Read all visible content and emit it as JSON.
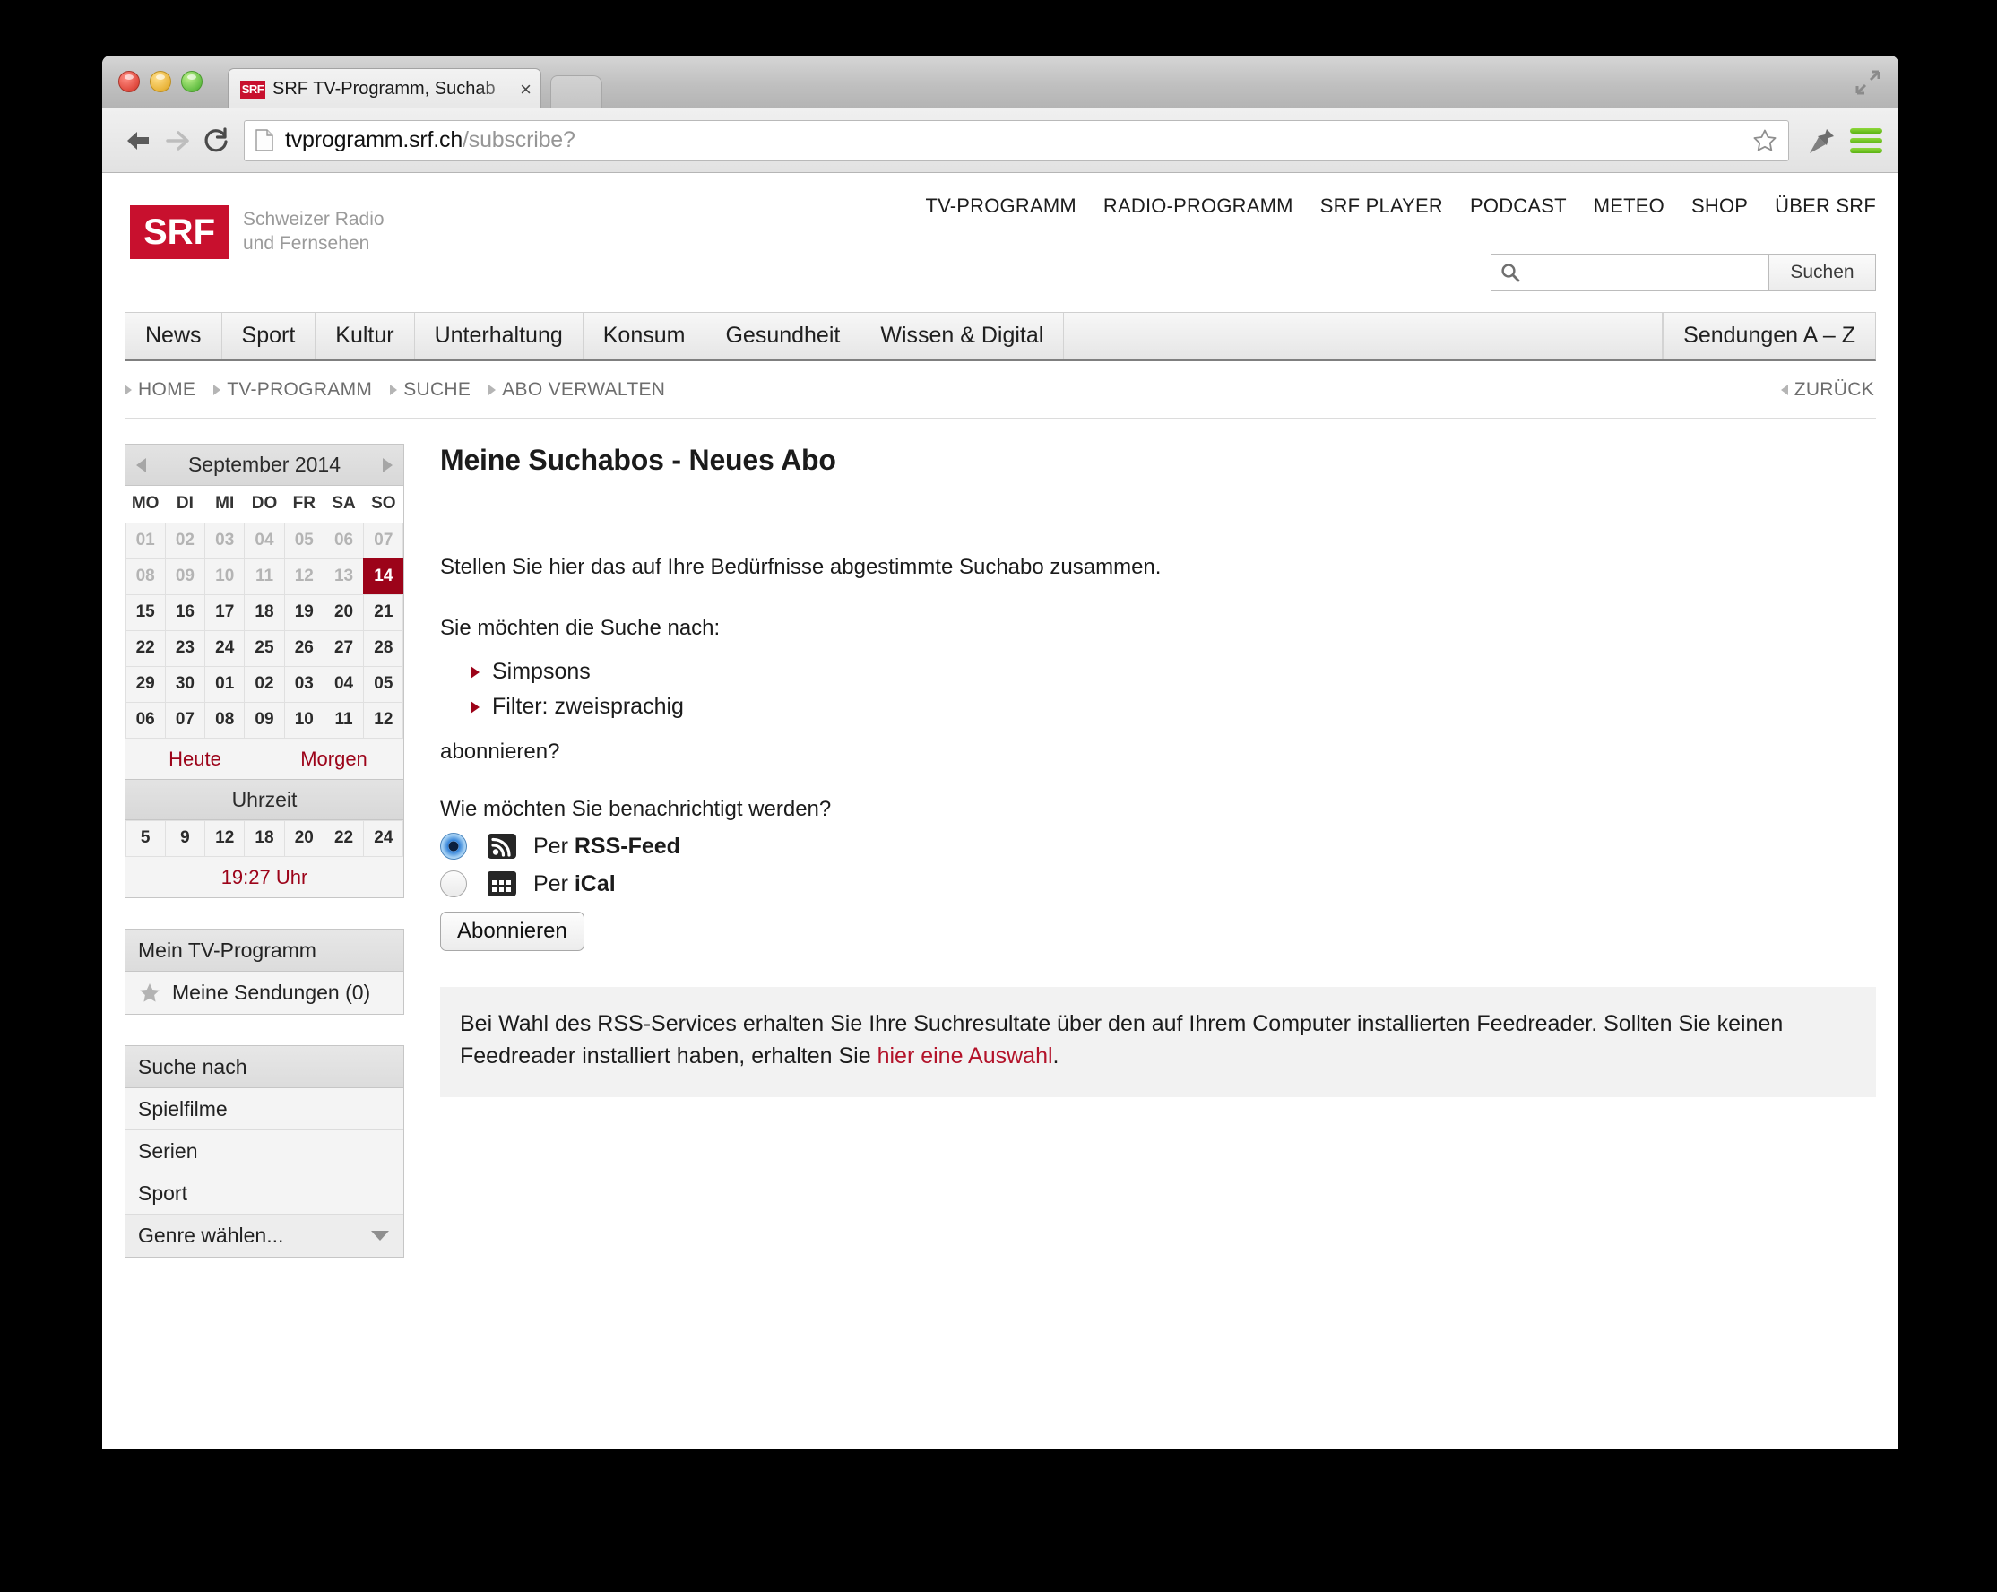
{
  "browser": {
    "tab": {
      "favicon_label": "SRF",
      "title": "SRF TV-Programm, Suchab",
      "close_label": "×"
    },
    "url": {
      "domain": "tvprogramm.srf.ch",
      "path": "/subscribe?"
    }
  },
  "site": {
    "logo": {
      "mark": "SRF",
      "line1": "Schweizer Radio",
      "line2": "und Fernsehen"
    },
    "top_nav": [
      "TV-PROGRAMM",
      "RADIO-PROGRAMM",
      "SRF PLAYER",
      "PODCAST",
      "METEO",
      "SHOP",
      "ÜBER SRF"
    ],
    "search": {
      "placeholder": "",
      "value": "",
      "submit_label": "Suchen"
    },
    "main_nav": [
      "News",
      "Sport",
      "Kultur",
      "Unterhaltung",
      "Konsum",
      "Gesundheit",
      "Wissen & Digital"
    ],
    "main_nav_right": "Sendungen A – Z",
    "breadcrumb": [
      "HOME",
      "TV-PROGRAMM",
      "SUCHE",
      "ABO VERWALTEN"
    ],
    "back_label": "ZURÜCK"
  },
  "sidebar": {
    "calendar": {
      "title": "September 2014",
      "dow": [
        "MO",
        "DI",
        "MI",
        "DO",
        "FR",
        "SA",
        "SO"
      ],
      "weeks": [
        [
          {
            "d": "01",
            "s": "muted"
          },
          {
            "d": "02",
            "s": "muted"
          },
          {
            "d": "03",
            "s": "muted"
          },
          {
            "d": "04",
            "s": "muted"
          },
          {
            "d": "05",
            "s": "muted"
          },
          {
            "d": "06",
            "s": "muted"
          },
          {
            "d": "07",
            "s": "muted"
          }
        ],
        [
          {
            "d": "08",
            "s": "muted"
          },
          {
            "d": "09",
            "s": "muted"
          },
          {
            "d": "10",
            "s": "muted"
          },
          {
            "d": "11",
            "s": "muted"
          },
          {
            "d": "12",
            "s": "muted"
          },
          {
            "d": "13",
            "s": "muted"
          },
          {
            "d": "14",
            "s": "today"
          }
        ],
        [
          {
            "d": "15",
            "s": ""
          },
          {
            "d": "16",
            "s": ""
          },
          {
            "d": "17",
            "s": ""
          },
          {
            "d": "18",
            "s": ""
          },
          {
            "d": "19",
            "s": ""
          },
          {
            "d": "20",
            "s": ""
          },
          {
            "d": "21",
            "s": ""
          }
        ],
        [
          {
            "d": "22",
            "s": ""
          },
          {
            "d": "23",
            "s": ""
          },
          {
            "d": "24",
            "s": ""
          },
          {
            "d": "25",
            "s": ""
          },
          {
            "d": "26",
            "s": ""
          },
          {
            "d": "27",
            "s": ""
          },
          {
            "d": "28",
            "s": ""
          }
        ],
        [
          {
            "d": "29",
            "s": ""
          },
          {
            "d": "30",
            "s": ""
          },
          {
            "d": "01",
            "s": ""
          },
          {
            "d": "02",
            "s": ""
          },
          {
            "d": "03",
            "s": ""
          },
          {
            "d": "04",
            "s": ""
          },
          {
            "d": "05",
            "s": ""
          }
        ],
        [
          {
            "d": "06",
            "s": ""
          },
          {
            "d": "07",
            "s": ""
          },
          {
            "d": "08",
            "s": ""
          },
          {
            "d": "09",
            "s": ""
          },
          {
            "d": "10",
            "s": ""
          },
          {
            "d": "11",
            "s": ""
          },
          {
            "d": "12",
            "s": ""
          }
        ]
      ],
      "today_label": "Heute",
      "tomorrow_label": "Morgen",
      "time_header": "Uhrzeit",
      "hours": [
        "5",
        "9",
        "12",
        "18",
        "20",
        "22",
        "24"
      ],
      "now_label": "19:27 Uhr"
    },
    "my_tv": {
      "header": "Mein TV-Programm",
      "my_shows": "Meine Sendungen (0)"
    },
    "search_for": {
      "header": "Suche nach",
      "items": [
        "Spielfilme",
        "Serien",
        "Sport"
      ],
      "genre_select": "Genre wählen..."
    }
  },
  "main": {
    "title": "Meine Suchabos - Neues Abo",
    "intro": "Stellen Sie hier das auf Ihre Bedürfnisse abgestimmte Suchabo zusammen.",
    "lead": "Sie möchten die Suche nach:",
    "criteria": [
      "Simpsons",
      "Filter: zweisprachig"
    ],
    "tail": "abonnieren?",
    "notify_question": "Wie möchten Sie benachrichtigt werden?",
    "options": [
      {
        "prefix": "Per ",
        "name": "RSS-Feed",
        "selected": true
      },
      {
        "prefix": "Per ",
        "name": "iCal",
        "selected": false
      }
    ],
    "submit_label": "Abonnieren",
    "info": {
      "text_before": "Bei Wahl des RSS-Services erhalten Sie Ihre Suchresultate über den auf Ihrem Computer installierten Feedreader. Sollten Sie keinen Feedreader installiert haben, erhalten Sie ",
      "link": "hier eine Auswahl",
      "text_after": "."
    }
  },
  "colors": {
    "brand_red": "#c8102e",
    "accent_red": "#9c0319",
    "link_red": "#b3132a"
  }
}
